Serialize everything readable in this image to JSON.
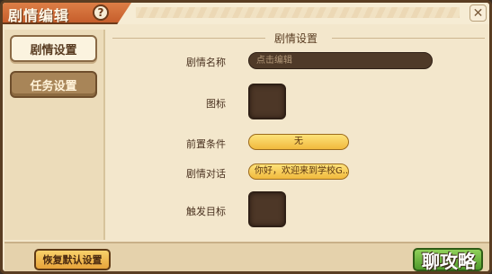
{
  "window": {
    "title": "剧情编辑",
    "help_glyph": "?",
    "close_glyph": "✕"
  },
  "sidebar": {
    "items": [
      {
        "label": "剧情设置",
        "active": true
      },
      {
        "label": "任务设置",
        "active": false
      }
    ]
  },
  "section": {
    "title": "剧情设置"
  },
  "form": {
    "name_label": "剧情名称",
    "name_placeholder": "点击编辑",
    "icon_label": "图标",
    "precondition_label": "前置条件",
    "precondition_value": "无",
    "dialogue_label": "剧情对话",
    "dialogue_value": "你好，欢迎来到学校G...",
    "trigger_label": "触发目标"
  },
  "footer": {
    "reset_label": "恢复默认设置",
    "watermark": "聊攻略"
  }
}
